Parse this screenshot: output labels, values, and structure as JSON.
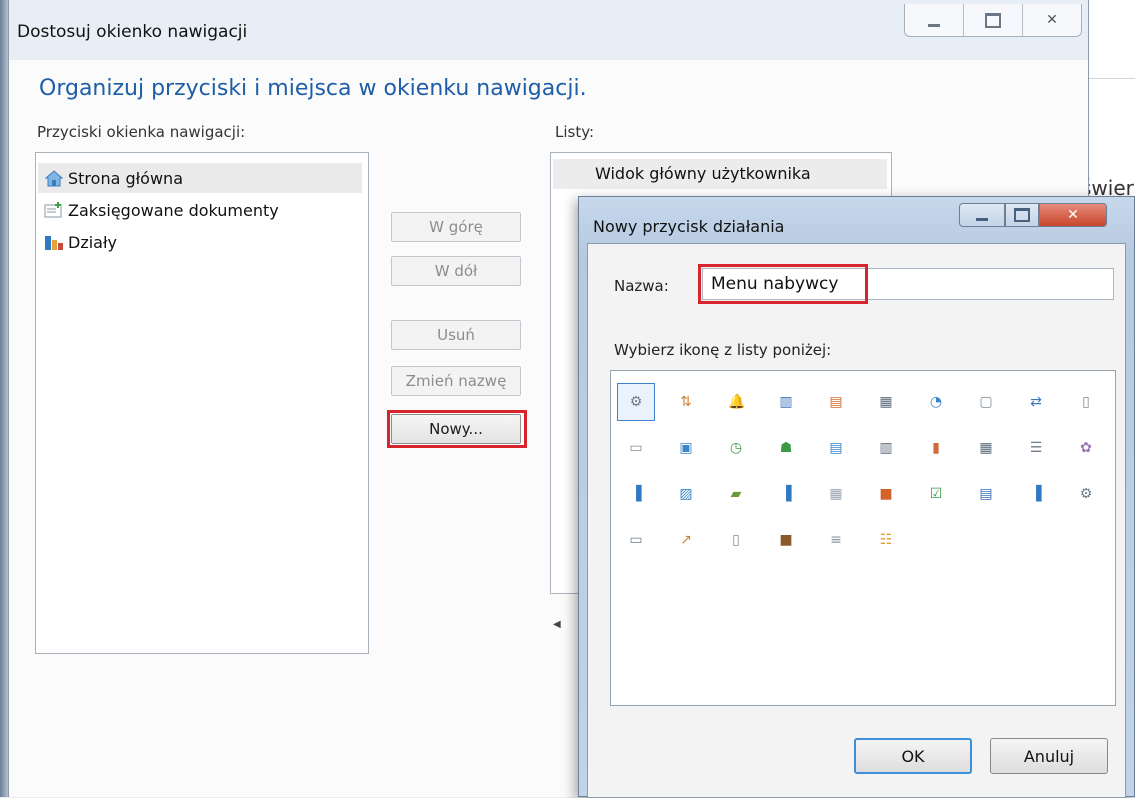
{
  "background": {
    "partial_text": "świer"
  },
  "main_dialog": {
    "title": "Dostosuj okienko nawigacji",
    "heading": "Organizuj przyciski i miejsca w okienku nawigacji.",
    "left_label": "Przyciski okienka nawigacji:",
    "right_label": "Listy:",
    "nav_buttons": [
      {
        "label": "Strona główna",
        "icon": "home-icon",
        "selected": true
      },
      {
        "label": "Zaksięgowane dokumenty",
        "icon": "posted-documents-icon",
        "selected": false
      },
      {
        "label": "Działy",
        "icon": "departments-icon",
        "selected": false
      }
    ],
    "buttons": {
      "up": "W górę",
      "down": "W dół",
      "remove": "Usuń",
      "rename": "Zmień nazwę",
      "new": "Nowy..."
    },
    "lists": [
      {
        "label": "Widok główny użytkownika",
        "selected": true
      }
    ]
  },
  "sub_dialog": {
    "title": "Nowy przycisk działania",
    "name_label": "Nazwa:",
    "name_value": "Menu nabywcy",
    "pick_label": "Wybierz ikonę z listy poniżej:",
    "icons": [
      "gears-icon",
      "sort-icon",
      "bell-icon",
      "chart-search-icon",
      "form-icon",
      "calculator-icon",
      "cycle-icon",
      "document-arrow-icon",
      "flow-icon",
      "page-arrow-icon",
      "new-entry-icon",
      "note-icon",
      "history-icon",
      "people-icon",
      "report-icon",
      "ledger-icon",
      "columns-icon",
      "table-icon",
      "list-icon",
      "purple-flower-icon",
      "bar-chart-icon",
      "picture-icon",
      "folder-icon",
      "bar-chart-up-icon",
      "grid-icon",
      "orange-book-icon",
      "checked-form-icon",
      "calendar-icon",
      "blue-bars-icon",
      "gears-small-icon",
      "tab-icon",
      "trend-icon",
      "copy-icon",
      "briefcase-icon",
      "lines-icon",
      "orgchart-icon"
    ],
    "ok_label": "OK",
    "cancel_label": "Anuluj",
    "colors": {
      "accent": "#1e5da8",
      "highlight": "#d8242d"
    }
  }
}
